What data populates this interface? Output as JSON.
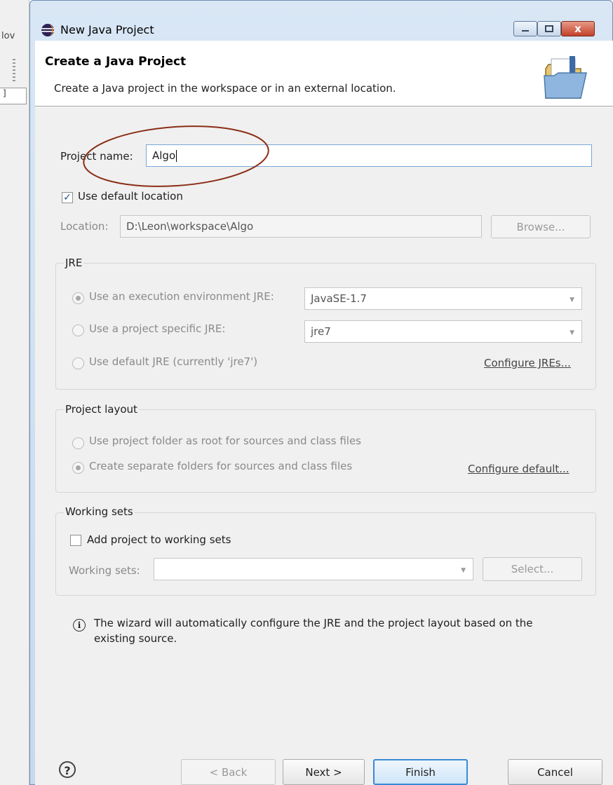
{
  "background_app": {
    "partial_text": "lov",
    "tab_text": "]"
  },
  "window": {
    "title": "New Java Project",
    "close_label": "x"
  },
  "header": {
    "title": "Create a Java Project",
    "description": "Create a Java project in the workspace or in an external location."
  },
  "project": {
    "name_label": "Project name:",
    "name_value": "Algo"
  },
  "location": {
    "use_default_label": "Use default location",
    "use_default_checked": true,
    "label": "Location:",
    "value": "D:\\Leon\\workspace\\Algo",
    "browse_label": "Browse..."
  },
  "jre": {
    "group_title": "JRE",
    "option_env_label": "Use an execution environment JRE:",
    "option_env_value": "JavaSE-1.7",
    "option_specific_label": "Use a project specific JRE:",
    "option_specific_value": "jre7",
    "option_default_label": "Use default JRE (currently 'jre7')",
    "configure_link": "Configure JREs..."
  },
  "layout": {
    "group_title": "Project layout",
    "option_root_label": "Use project folder as root for sources and class files",
    "option_separate_label": "Create separate folders for sources and class files",
    "configure_link": "Configure default..."
  },
  "working_sets": {
    "group_title": "Working sets",
    "add_label": "Add project to working sets",
    "add_checked": false,
    "field_label": "Working sets:",
    "field_value": "",
    "select_label": "Select..."
  },
  "info": {
    "icon_glyph": "i",
    "text_line1": "The wizard will automatically configure the JRE and the project layout based on the",
    "text_line2": "existing source."
  },
  "footer": {
    "help_glyph": "?",
    "back_label": "< Back",
    "next_label": "Next >",
    "finish_label": "Finish",
    "cancel_label": "Cancel"
  },
  "colors": {
    "annotation_ellipse": "#8b2e16",
    "title_bar": "#c6d9ee",
    "focus_border": "#7aa7d6"
  }
}
